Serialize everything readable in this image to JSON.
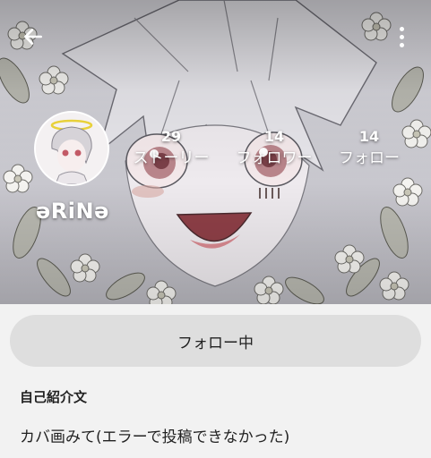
{
  "header": {
    "back_icon": "arrow-left-icon",
    "menu_icon": "more-vertical-icon"
  },
  "profile": {
    "username": "əRiNə",
    "stats": [
      {
        "count": "29",
        "label": "ストーリー"
      },
      {
        "count": "14",
        "label": "フォロワー"
      },
      {
        "count": "14",
        "label": "フォロー"
      }
    ]
  },
  "follow_button": {
    "label": "フォロー中"
  },
  "bio": {
    "heading": "自己紹介文",
    "text": "カバ画みて(エラーで投稿できなかった)"
  },
  "colors": {
    "page_background": "#f2f2f2",
    "button_background": "#dedede",
    "text": "#222222",
    "overlay_text": "#ffffff"
  }
}
